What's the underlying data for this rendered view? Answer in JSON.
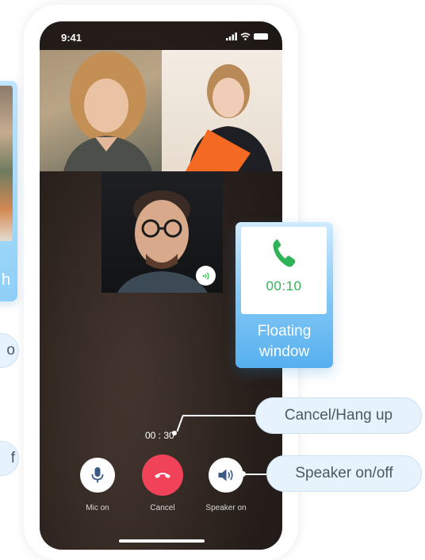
{
  "status_bar": {
    "time": "9:41"
  },
  "left_annotations": {
    "panel_text": "h",
    "pill_1_text": "o",
    "pill_2_text": "f"
  },
  "call": {
    "timer": "00 : 30",
    "controls": [
      {
        "label": "Mic on",
        "icon": "microphone-icon"
      },
      {
        "label": "Cancel",
        "icon": "hang-up-icon"
      },
      {
        "label": "Speaker on",
        "icon": "speaker-icon"
      }
    ]
  },
  "floating_window": {
    "timer": "00:10",
    "caption_line1": "Floating",
    "caption_line2": "window",
    "icon": "phone-icon"
  },
  "callouts": {
    "cancel": "Cancel/Hang up",
    "speaker": "Speaker on/off"
  },
  "colors": {
    "hangup_red": "#f0435a",
    "accent_green": "#2fb357",
    "callout_bg": "#e6f2fc",
    "panel_blue": "#56b0ef"
  }
}
